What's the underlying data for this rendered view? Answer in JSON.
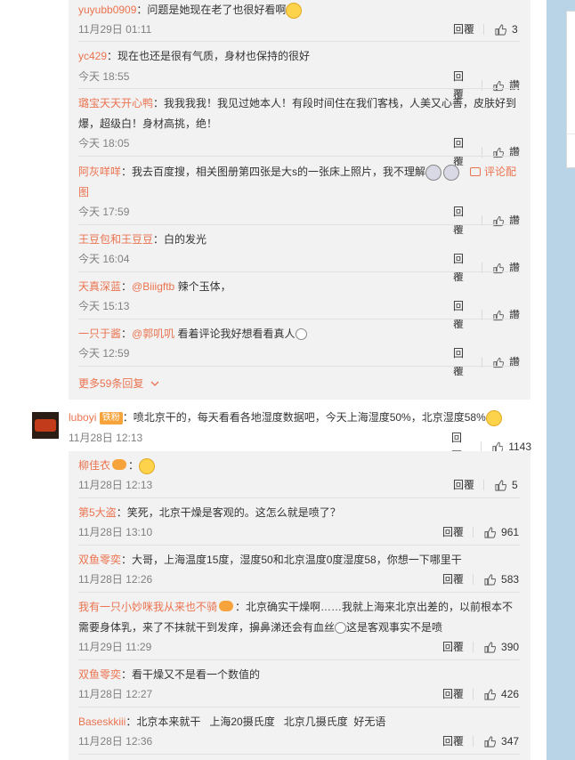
{
  "thread1": {
    "replies": [
      {
        "user": "yuyubb0909",
        "text": "：问题是她现在老了也很好看啊",
        "time": "11月29日 01:11",
        "reply_label": "回覆",
        "likes": "3"
      },
      {
        "user": "yc429",
        "text": "：现在也还是很有气质，身材也保持的很好",
        "time": "今天 18:55",
        "reply_label": "回覆",
        "likes": "讚"
      },
      {
        "user": "璐宝天天开心鸭",
        "text1": "：我我我我！我见过她本人！有段时间住在我们客栈，人美又心善，皮肤好到",
        "text2": "爆，超级白！身材高挑，绝！",
        "time": "今天 18:05",
        "reply_label": "回覆",
        "likes": "讚"
      },
      {
        "user": "阿灰咩咩",
        "text1": "：我去百度搜，相关图册第四张是大s的一张床上照片，我不理解",
        "comment_link": "评论配",
        "text2": "图",
        "time": "今天 17:59",
        "reply_label": "回覆",
        "likes": "讚"
      },
      {
        "user": "王豆包和王豆豆",
        "text": "：白的发光",
        "time": "今天 16:04",
        "reply_label": "回覆",
        "likes": "讚"
      },
      {
        "user": "天真深蓝",
        "mention": "@Biiigftb",
        "text": " 辣个玉体，",
        "time": "今天 15:13",
        "reply_label": "回覆",
        "likes": "讚"
      },
      {
        "user": "一只于酱",
        "mention": "@郭叽叽",
        "text": " 看着评论我好想看看真人",
        "time": "今天 12:59",
        "reply_label": "回覆",
        "likes": "讚"
      }
    ],
    "more": "更多59条回复"
  },
  "comment2": {
    "user": "luboyi",
    "badge": "铁粉",
    "text": "：喷北京干的，每天看看各地湿度数据吧，今天上海湿度50%，北京湿度58%",
    "time": "11月28日 12:13",
    "reply_label": "回覆",
    "likes": "1143"
  },
  "thread2": {
    "replies": [
      {
        "user": "柳佳衣",
        "text": "：",
        "time": "11月28日 12:13",
        "reply_label": "回覆",
        "likes": "5"
      },
      {
        "user": "第5大盗",
        "text": "：笑死，北京干燥是客观的。这怎么就是喷了？",
        "time": "11月28日 13:10",
        "reply_label": "回覆",
        "likes": "961"
      },
      {
        "user": "双鱼零奕",
        "text": "：大哥，上海温度15度，湿度50和北京温度0度湿度58，你想一下哪里干",
        "time": "11月28日 12:26",
        "reply_label": "回覆",
        "likes": "583"
      },
      {
        "user": "我有一只小妙咪我从来也不骑",
        "text1": "：北京确实干燥啊……我就上海来北京出差的，以前根本不",
        "text2": "需要身体乳，来了不抹就干到发痒，擤鼻涕还会有血丝",
        "text3": "这是客观事实不是喷",
        "time": "11月29日 11:29",
        "reply_label": "回覆",
        "likes": "390"
      },
      {
        "user": "双鱼零奕",
        "text": "：看干燥又不是看一个数值的",
        "time": "11月28日 12:27",
        "reply_label": "回覆",
        "likes": "426"
      },
      {
        "user": "Baseskkiii",
        "text": "：北京本来就干   上海20摄氏度   北京几摄氏度  好无语",
        "time": "11月28日 12:36",
        "reply_label": "回覆",
        "likes": "347"
      }
    ]
  },
  "colors": {
    "username": "#eb7350",
    "time": "#808080",
    "reply_bg": "#f2f2f2",
    "page_bg": "#b9d4e6"
  },
  "icons": [
    "thumb-up-icon",
    "emoji-icon",
    "comment-icon",
    "chevron-down-icon",
    "avatar"
  ]
}
